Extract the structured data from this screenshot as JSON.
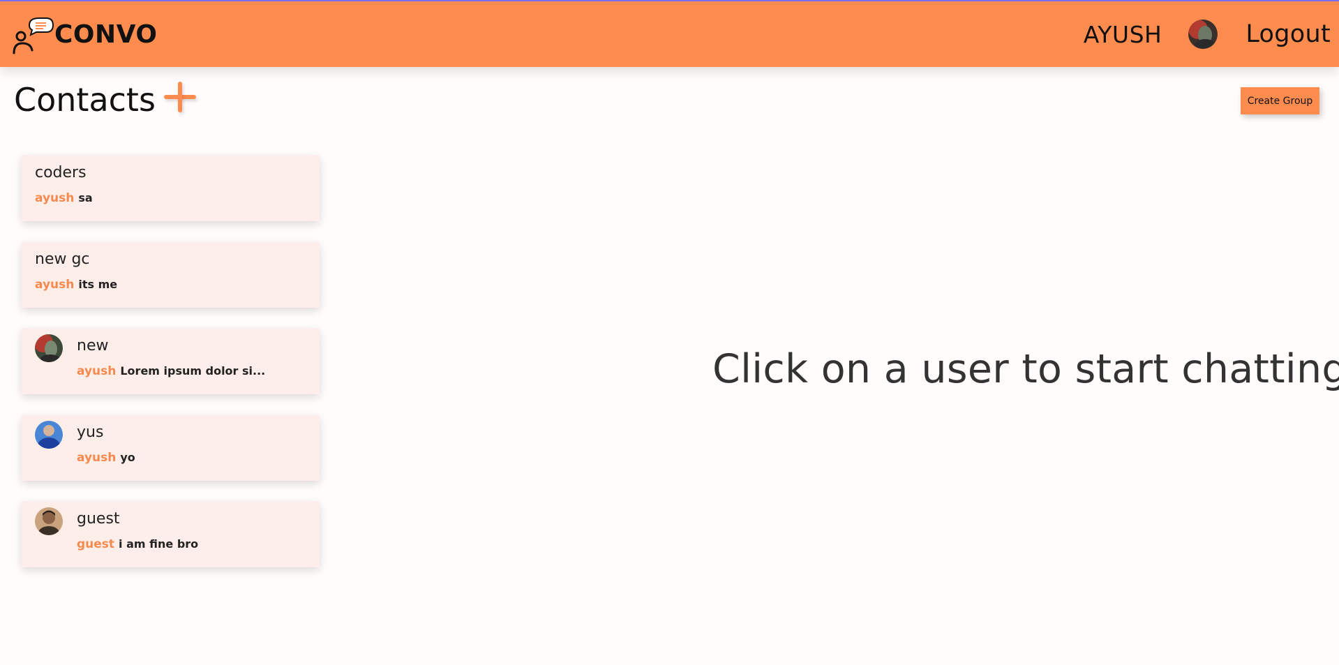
{
  "navbar": {
    "brand": "CONVO",
    "username": "AYUSH",
    "logout_label": "Logout",
    "accent_color": "#ff8c4f"
  },
  "contacts": {
    "title": "Contacts",
    "add_icon": "plus-icon",
    "create_group_label": "Create Group",
    "items": [
      {
        "name": "coders",
        "sender": "ayush",
        "message": "sa",
        "avatar": false
      },
      {
        "name": "new gc",
        "sender": "ayush",
        "message": "its me",
        "avatar": false
      },
      {
        "name": "new",
        "sender": "ayush",
        "message": "Lorem ipsum dolor si...",
        "avatar": true,
        "avatar_colors": [
          "#b23a2f",
          "#3d4a3a"
        ]
      },
      {
        "name": "yus",
        "sender": "ayush",
        "message": "yo",
        "avatar": true,
        "avatar_colors": [
          "#1f3f9e",
          "#4a86d6"
        ]
      },
      {
        "name": "guest",
        "sender": "guest",
        "message": "i am fine bro",
        "avatar": true,
        "avatar_colors": [
          "#3b3026",
          "#c9a27e"
        ]
      }
    ]
  },
  "main": {
    "empty_message": "Click on a user to start chatting"
  }
}
